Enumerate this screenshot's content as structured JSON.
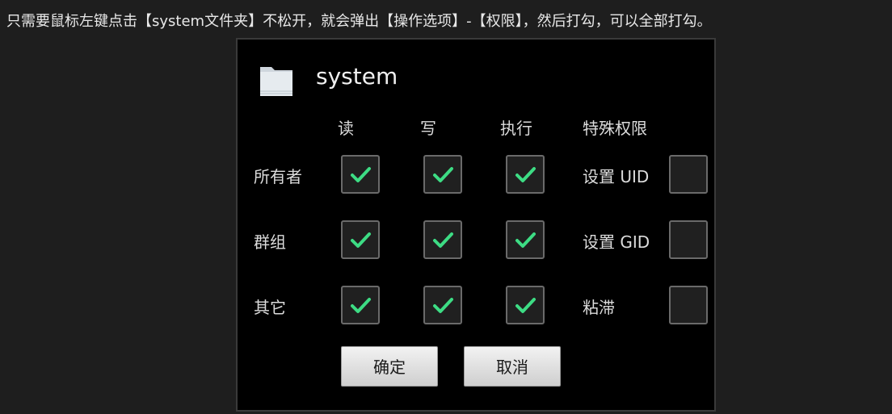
{
  "instruction": "只需要鼠标左键点击【system文件夹】不松开，就会弹出【操作选项】-【权限】，然后打勾，可以全部打勾。",
  "dialog": {
    "title": "system",
    "columns": [
      "读",
      "写",
      "执行",
      "特殊权限"
    ],
    "rows": [
      {
        "label": "所有者",
        "read": true,
        "write": true,
        "execute": true,
        "special_label": "设置 UID",
        "special": false
      },
      {
        "label": "群组",
        "read": true,
        "write": true,
        "execute": true,
        "special_label": "设置 GID",
        "special": false
      },
      {
        "label": "其它",
        "read": true,
        "write": true,
        "execute": true,
        "special_label": "粘滞",
        "special": false
      }
    ],
    "buttons": {
      "ok": "确定",
      "cancel": "取消"
    }
  },
  "colors": {
    "check_mark": "#3ddc84",
    "dialog_bg": "#000000",
    "page_bg": "#1e1e1e"
  },
  "icons": {
    "folder": "folder-icon",
    "check": "check-icon"
  }
}
